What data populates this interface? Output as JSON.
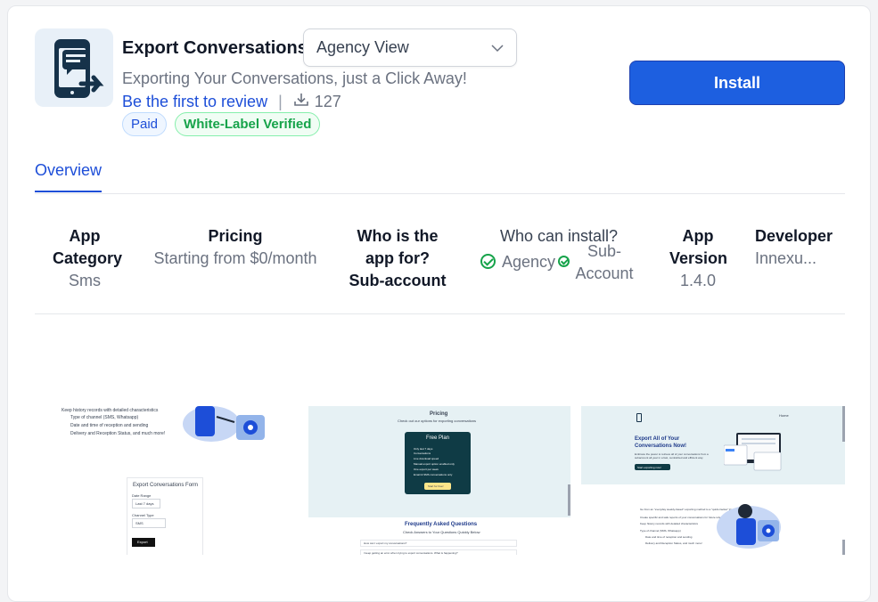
{
  "app": {
    "title": "Export Conversations",
    "subtitle": "Exporting Your Conversations, just a Click Away!",
    "review_link": "Be the first to review",
    "downloads": "127",
    "badges": {
      "paid": "Paid",
      "white_label": "White-Label Verified"
    },
    "install_label": "Install"
  },
  "view_select": {
    "value": "Agency View"
  },
  "tabs": [
    {
      "label": "Overview"
    }
  ],
  "info": {
    "category": {
      "label_line1": "App",
      "label_line2": "Category",
      "value": "Sms"
    },
    "pricing": {
      "label": "Pricing",
      "value": "Starting from $0/month"
    },
    "who_for": {
      "label_line1": "Who is the",
      "label_line2": "app for?",
      "value": "Sub-account"
    },
    "who_install": {
      "label": "Who can install?",
      "opt1": "Agency",
      "opt2_line1": "Sub-",
      "opt2_line2": "Account"
    },
    "version": {
      "label_line1": "App",
      "label_line2": "Version",
      "value": "1.4.0"
    },
    "developer": {
      "label": "Developer",
      "value": "Innexu..."
    }
  },
  "screenshots": {
    "s1": {
      "bullets": [
        "Keep history records with detailed characteristics",
        "Type of channel (SMS, Whatsapp)",
        "Date and time of reception and sending",
        "Delivery and Reception Status, and much more!"
      ],
      "form_title": "Export Conversations Form",
      "date_range_label": "Date Range",
      "date_range_value": "Last 7 days",
      "channel_label": "Channel Type",
      "channel_value": "SMS",
      "export_btn": "Export"
    },
    "s2": {
      "pricing_title": "Pricing",
      "pricing_sub": "Check out our options for exporting conversations",
      "plan_title": "Free Plan",
      "plan_features": [
        "Only last 7 days",
        "Conversations",
        "Live download speed",
        "Manual export option enabled only",
        "One export per week",
        "Email & SMS conversations only"
      ],
      "plan_btn": "Start for free!",
      "faq_title": "Frequently Asked Questions",
      "faq_sub": "Check Answers to Your Questions Quickly Below",
      "faq_q1": "How can I export my conversations?",
      "faq_q2": "I keep getting an error when trying to export conversations. What is happening?"
    },
    "s3": {
      "nav_item": "Home",
      "hero_title_1": "Export All of Your",
      "hero_title_2": "Conversations Now!",
      "hero_text": "Embrace the power to retrieve all of your conversations from a subaccount all year in a fast, centralized and efficient way.",
      "hero_btn": "Start exporting now!",
      "bullets": [
        "Go from an \"everyday weekly-based\" exporting method to a \"quick-tracker\" kind of method.",
        "Create specific and safe reports of your conversations for future references.",
        "Keep history records with detailed characteristics",
        "Type of channel (SMS, Whatsapp)",
        "Date and time of reception and sending",
        "Delivery and Reception Status, and much more!"
      ]
    }
  },
  "colors": {
    "primary": "#1d5fe0",
    "link": "#1d4ed8",
    "success": "#16a34a",
    "hero_bg": "#e6f1f4",
    "plan_bg": "#0f3b45"
  }
}
